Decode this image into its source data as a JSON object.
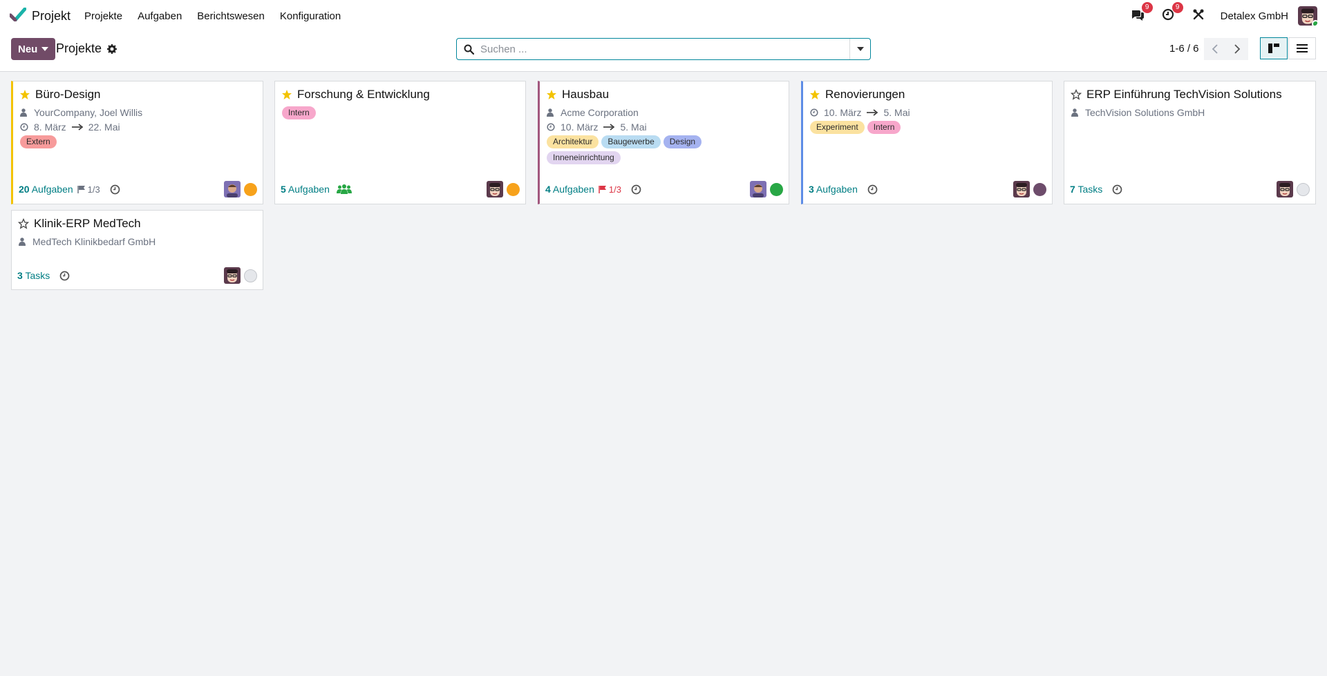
{
  "app": {
    "name": "Projekt",
    "menu": [
      "Projekte",
      "Aufgaben",
      "Berichtswesen",
      "Konfiguration"
    ],
    "messages_badge": "9",
    "activities_badge": "9",
    "company": "Detalex GmbH"
  },
  "control": {
    "new_label": "Neu",
    "breadcrumb": "Projekte",
    "search_placeholder": "Suchen ...",
    "pager": "1-6 / 6"
  },
  "colors": {
    "brand": "#714b67",
    "teal": "#017e84",
    "status_orange": "#f7a21b",
    "status_green": "#28a745",
    "status_purple": "#6d4c6b",
    "status_none": "#e5e7eb"
  },
  "projects": [
    {
      "name": "Büro-Design",
      "favorite": true,
      "customer": "YourCompany, Joel Willis",
      "date_start": "8. März",
      "date_end": "22. Mai",
      "tags": [
        "Extern"
      ],
      "tasks_count": "20",
      "tasks_label": "Aufgaben",
      "milestone": "1/3",
      "status": "orange"
    },
    {
      "name": "Forschung & Entwicklung",
      "favorite": true,
      "tags": [
        "Intern"
      ],
      "tasks_count": "5",
      "tasks_label": "Aufgaben",
      "status": "orange"
    },
    {
      "name": "Hausbau",
      "favorite": true,
      "customer": "Acme Corporation",
      "date_start": "10. März",
      "date_end": "5. Mai",
      "tags": [
        "Architektur",
        "Baugewerbe",
        "Design",
        "Inneneinrichtung"
      ],
      "tasks_count": "4",
      "tasks_label": "Aufgaben",
      "milestone": "1/3",
      "status": "green"
    },
    {
      "name": "Renovierungen",
      "favorite": true,
      "date_start": "10. März",
      "date_end": "5. Mai",
      "tags": [
        "Experiment",
        "Intern"
      ],
      "tasks_count": "3",
      "tasks_label": "Aufgaben",
      "status": "purple"
    },
    {
      "name": "ERP Einführung TechVision Solutions",
      "favorite": false,
      "customer": "TechVision Solutions GmbH",
      "tasks_count": "7",
      "tasks_label": "Tasks",
      "status": "none"
    },
    {
      "name": "Klinik-ERP MedTech",
      "favorite": false,
      "customer": "MedTech Klinikbedarf GmbH",
      "tasks_count": "3",
      "tasks_label": "Tasks",
      "status": "none"
    }
  ]
}
